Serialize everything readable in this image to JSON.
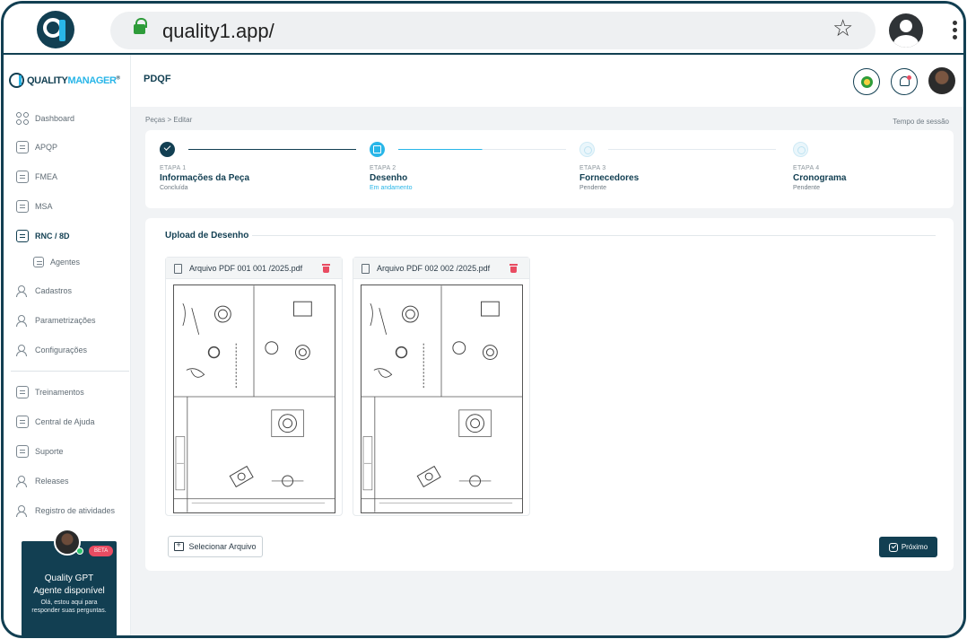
{
  "browser": {
    "url": "quality1.app/"
  },
  "brand": {
    "name_part1": "QUALITY",
    "name_part2": "MANAGER",
    "reg": "®"
  },
  "sidebar": {
    "items": [
      {
        "label": "Dashboard",
        "icon": "grid-icon"
      },
      {
        "label": "APQP",
        "icon": "document-icon"
      },
      {
        "label": "FMEA",
        "icon": "document-icon"
      },
      {
        "label": "MSA",
        "icon": "document-icon"
      },
      {
        "label": "RNC / 8D",
        "icon": "document-icon",
        "active": true
      },
      {
        "label": "Agentes",
        "icon": "document-icon"
      },
      {
        "label": "Cadastros",
        "icon": "users-icon"
      },
      {
        "label": "Parametrizações",
        "icon": "users-icon"
      },
      {
        "label": "Configurações",
        "icon": "users-icon"
      },
      {
        "label": "Treinamentos",
        "icon": "document-icon"
      },
      {
        "label": "Central de Ajuda",
        "icon": "document-icon"
      },
      {
        "label": "Suporte",
        "icon": "document-icon"
      },
      {
        "label": "Releases",
        "icon": "users-icon"
      },
      {
        "label": "Registro de atividades",
        "icon": "users-icon"
      }
    ]
  },
  "gpt": {
    "badge": "BETA",
    "title": "Quality GPT",
    "subtitle": "Agente disponível",
    "description": "Olá, estou aqui para responder suas perguntas."
  },
  "header": {
    "title": "PDQF"
  },
  "breadcrumb": "Peças > Editar",
  "session": "Tempo de sessão",
  "steps": [
    {
      "label": "ETAPA 1",
      "name": "Informações da Peça",
      "status": "Concluída",
      "state": "done"
    },
    {
      "label": "ETAPA 2",
      "name": "Desenho",
      "status": "Em andamento",
      "state": "current"
    },
    {
      "label": "ETAPA 3",
      "name": "Fornecedores",
      "status": "Pendente",
      "state": "pending"
    },
    {
      "label": "ETAPA 4",
      "name": "Cronograma",
      "status": "Pendente",
      "state": "pending"
    }
  ],
  "upload": {
    "title": "Upload de Desenho",
    "files": [
      {
        "name": "Arquivo PDF 001 001 /2025.pdf"
      },
      {
        "name": "Arquivo PDF 002 002 /2025.pdf"
      }
    ],
    "select_label": "Selecionar Arquivo",
    "next_label": "Próximo"
  },
  "colors": {
    "primary": "#123f52",
    "accent": "#29b6e8",
    "danger": "#e94c62"
  }
}
